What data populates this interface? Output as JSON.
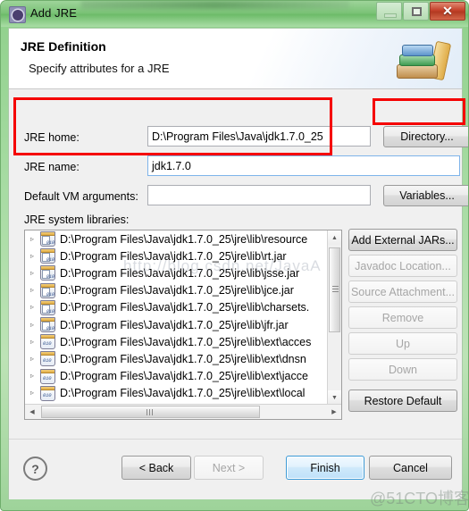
{
  "window": {
    "title": "Add JRE",
    "icon": "jre-gear-icon",
    "controls": {
      "minimize": "–",
      "maximize": "□",
      "close": "✕"
    },
    "frame_color": "#8fd08b"
  },
  "header": {
    "title": "JRE Definition",
    "subtitle": "Specify attributes for a JRE",
    "icon": "books-stack-icon"
  },
  "form": {
    "jre_home": {
      "label": "JRE home:",
      "value": "D:\\Program Files\\Java\\jdk1.7.0_25",
      "placeholder": ""
    },
    "jre_name": {
      "label": "JRE name:",
      "value": "jdk1.7.0",
      "placeholder": ""
    },
    "vm_args": {
      "label": "Default VM arguments:",
      "value": "",
      "placeholder": ""
    },
    "directory_button": "Directory...",
    "variables_button": "Variables..."
  },
  "libraries": {
    "label": "JRE system libraries:",
    "items": [
      {
        "text": "D:\\Program Files\\Java\\jdk1.7.0_25\\jre\\lib\\resource",
        "icon": "jar-doc-icon"
      },
      {
        "text": "D:\\Program Files\\Java\\jdk1.7.0_25\\jre\\lib\\rt.jar",
        "icon": "jar-doc-icon"
      },
      {
        "text": "D:\\Program Files\\Java\\jdk1.7.0_25\\jre\\lib\\jsse.jar",
        "icon": "jar-doc-icon"
      },
      {
        "text": "D:\\Program Files\\Java\\jdk1.7.0_25\\jre\\lib\\jce.jar",
        "icon": "jar-doc-icon"
      },
      {
        "text": "D:\\Program Files\\Java\\jdk1.7.0_25\\jre\\lib\\charsets.",
        "icon": "jar-doc-icon"
      },
      {
        "text": "D:\\Program Files\\Java\\jdk1.7.0_25\\jre\\lib\\jfr.jar",
        "icon": "jar-doc-icon"
      },
      {
        "text": "D:\\Program Files\\Java\\jdk1.7.0_25\\jre\\lib\\ext\\acces",
        "icon": "jar-icon"
      },
      {
        "text": "D:\\Program Files\\Java\\jdk1.7.0_25\\jre\\lib\\ext\\dnsn",
        "icon": "jar-icon"
      },
      {
        "text": "D:\\Program Files\\Java\\jdk1.7.0_25\\jre\\lib\\ext\\jacce",
        "icon": "jar-icon"
      },
      {
        "text": "D:\\Program Files\\Java\\jdk1.7.0_25\\jre\\lib\\ext\\local",
        "icon": "jar-icon"
      }
    ],
    "expander_glyph": "▹",
    "scroll": {
      "up_glyph": "▲",
      "down_glyph": "▼",
      "left_glyph": "◀",
      "right_glyph": "▶"
    }
  },
  "side_buttons": [
    {
      "label": "Add External JARs...",
      "enabled": true
    },
    {
      "label": "Javadoc Location...",
      "enabled": false
    },
    {
      "label": "Source Attachment...",
      "enabled": false
    },
    {
      "label": "Remove",
      "enabled": false
    },
    {
      "label": "Up",
      "enabled": false
    },
    {
      "label": "Down",
      "enabled": false
    },
    {
      "label": "Restore Default",
      "enabled": true
    }
  ],
  "footer": {
    "help_glyph": "?",
    "buttons": [
      {
        "label": "< Back",
        "state": "normal"
      },
      {
        "label": "Next >",
        "state": "disabled"
      },
      {
        "label": "Finish",
        "state": "primary"
      },
      {
        "label": "Cancel",
        "state": "normal"
      }
    ]
  },
  "annotations": {
    "highlight_color": "#f50000",
    "boxes": [
      "jre-home-and-name-fields",
      "directory-button"
    ]
  },
  "watermarks": {
    "url": "http://blog.csdn.net/JavaA",
    "site": "@51CTO博客"
  }
}
